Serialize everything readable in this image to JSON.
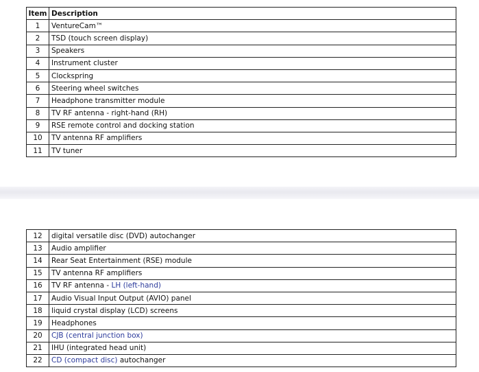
{
  "headers": {
    "item": "Item",
    "description": "Description"
  },
  "rows_part1": [
    {
      "item": "1",
      "desc": "VentureCam™"
    },
    {
      "item": "2",
      "desc": "TSD (touch screen display)"
    },
    {
      "item": "3",
      "desc": "Speakers"
    },
    {
      "item": "4",
      "desc": "Instrument cluster"
    },
    {
      "item": "5",
      "desc": "Clockspring"
    },
    {
      "item": "6",
      "desc": "Steering wheel switches"
    },
    {
      "item": "7",
      "desc": "Headphone transmitter module"
    },
    {
      "item": "8",
      "desc": "TV RF antenna - right-hand (RH)"
    },
    {
      "item": "9",
      "desc": "RSE remote control and docking station"
    },
    {
      "item": "10",
      "desc": "TV antenna RF amplifiers"
    },
    {
      "item": "11",
      "desc": "TV tuner"
    }
  ],
  "rows_part2": [
    {
      "item": "12",
      "desc": "digital versatile disc (DVD) autochanger"
    },
    {
      "item": "13",
      "desc": "Audio amplifier"
    },
    {
      "item": "14",
      "desc": "Rear Seat Entertainment (RSE) module"
    },
    {
      "item": "15",
      "desc": "TV antenna RF amplifiers"
    },
    {
      "item": "16",
      "desc_prefix": "TV RF antenna - ",
      "desc_link": "LH (left-hand)"
    },
    {
      "item": "17",
      "desc": "Audio Visual Input Output (AVIO) panel"
    },
    {
      "item": "18",
      "desc": "liquid crystal display (LCD) screens"
    },
    {
      "item": "19",
      "desc": "Headphones"
    },
    {
      "item": "20",
      "desc_link": "CJB (central junction box)"
    },
    {
      "item": "21",
      "desc": "IHU (integrated head unit)"
    },
    {
      "item": "22",
      "desc_link": "CD (compact disc)",
      "desc_suffix": " autochanger"
    }
  ],
  "colors": {
    "link": "#2b3a9b",
    "border": "#222222",
    "divider": "#e9e9ef"
  }
}
